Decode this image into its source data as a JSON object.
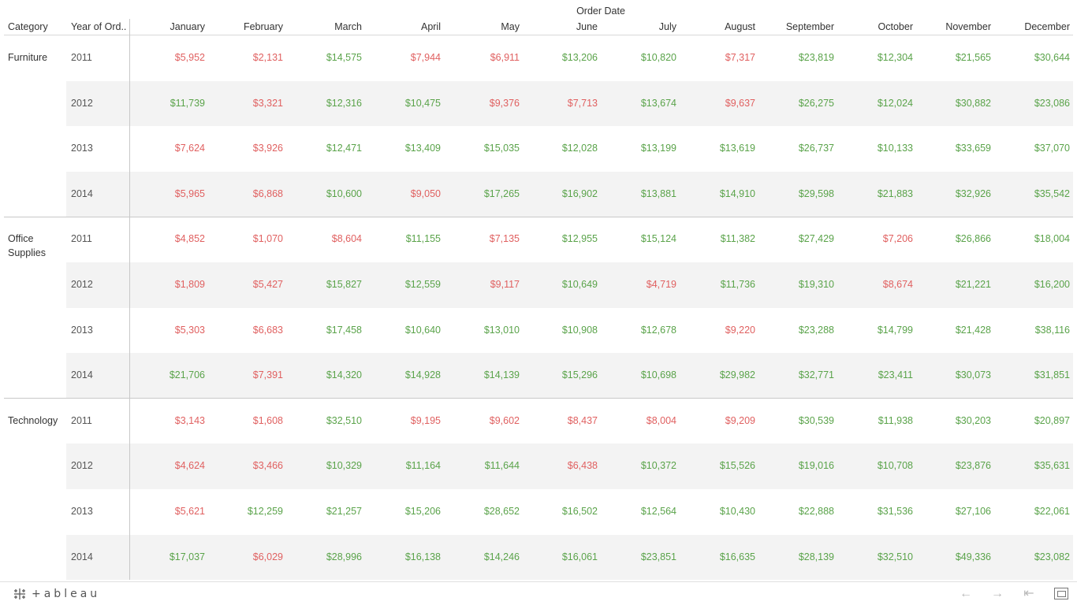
{
  "chart_data": {
    "type": "table",
    "column_group_title": "Order Date",
    "row_headers": [
      "Category",
      "Year of Ord.."
    ],
    "months": [
      "January",
      "February",
      "March",
      "April",
      "May",
      "June",
      "July",
      "August",
      "September",
      "October",
      "November",
      "December"
    ],
    "rows": [
      {
        "category": "Furniture",
        "years": [
          {
            "year": "2011",
            "values": [
              "$5,952",
              "$2,131",
              "$14,575",
              "$7,944",
              "$6,911",
              "$13,206",
              "$10,820",
              "$7,317",
              "$23,819",
              "$12,304",
              "$21,565",
              "$30,644"
            ],
            "positive": [
              0,
              0,
              1,
              0,
              0,
              1,
              1,
              0,
              1,
              1,
              1,
              1
            ]
          },
          {
            "year": "2012",
            "values": [
              "$11,739",
              "$3,321",
              "$12,316",
              "$10,475",
              "$9,376",
              "$7,713",
              "$13,674",
              "$9,637",
              "$26,275",
              "$12,024",
              "$30,882",
              "$23,086"
            ],
            "positive": [
              1,
              0,
              1,
              1,
              0,
              0,
              1,
              0,
              1,
              1,
              1,
              1
            ]
          },
          {
            "year": "2013",
            "values": [
              "$7,624",
              "$3,926",
              "$12,471",
              "$13,409",
              "$15,035",
              "$12,028",
              "$13,199",
              "$13,619",
              "$26,737",
              "$10,133",
              "$33,659",
              "$37,070"
            ],
            "positive": [
              0,
              0,
              1,
              1,
              1,
              1,
              1,
              1,
              1,
              1,
              1,
              1
            ]
          },
          {
            "year": "2014",
            "values": [
              "$5,965",
              "$6,868",
              "$10,600",
              "$9,050",
              "$17,265",
              "$16,902",
              "$13,881",
              "$14,910",
              "$29,598",
              "$21,883",
              "$32,926",
              "$35,542"
            ],
            "positive": [
              0,
              0,
              1,
              0,
              1,
              1,
              1,
              1,
              1,
              1,
              1,
              1
            ]
          }
        ]
      },
      {
        "category": "Office Supplies",
        "years": [
          {
            "year": "2011",
            "values": [
              "$4,852",
              "$1,070",
              "$8,604",
              "$11,155",
              "$7,135",
              "$12,955",
              "$15,124",
              "$11,382",
              "$27,429",
              "$7,206",
              "$26,866",
              "$18,004"
            ],
            "positive": [
              0,
              0,
              0,
              1,
              0,
              1,
              1,
              1,
              1,
              0,
              1,
              1
            ]
          },
          {
            "year": "2012",
            "values": [
              "$1,809",
              "$5,427",
              "$15,827",
              "$12,559",
              "$9,117",
              "$10,649",
              "$4,719",
              "$11,736",
              "$19,310",
              "$8,674",
              "$21,221",
              "$16,200"
            ],
            "positive": [
              0,
              0,
              1,
              1,
              0,
              1,
              0,
              1,
              1,
              0,
              1,
              1
            ]
          },
          {
            "year": "2013",
            "values": [
              "$5,303",
              "$6,683",
              "$17,458",
              "$10,640",
              "$13,010",
              "$10,908",
              "$12,678",
              "$9,220",
              "$23,288",
              "$14,799",
              "$21,428",
              "$38,116"
            ],
            "positive": [
              0,
              0,
              1,
              1,
              1,
              1,
              1,
              0,
              1,
              1,
              1,
              1
            ]
          },
          {
            "year": "2014",
            "values": [
              "$21,706",
              "$7,391",
              "$14,320",
              "$14,928",
              "$14,139",
              "$15,296",
              "$10,698",
              "$29,982",
              "$32,771",
              "$23,411",
              "$30,073",
              "$31,851"
            ],
            "positive": [
              1,
              0,
              1,
              1,
              1,
              1,
              1,
              1,
              1,
              1,
              1,
              1
            ]
          }
        ]
      },
      {
        "category": "Technology",
        "years": [
          {
            "year": "2011",
            "values": [
              "$3,143",
              "$1,608",
              "$32,510",
              "$9,195",
              "$9,602",
              "$8,437",
              "$8,004",
              "$9,209",
              "$30,539",
              "$11,938",
              "$30,203",
              "$20,897"
            ],
            "positive": [
              0,
              0,
              1,
              0,
              0,
              0,
              0,
              0,
              1,
              1,
              1,
              1
            ]
          },
          {
            "year": "2012",
            "values": [
              "$4,624",
              "$3,466",
              "$10,329",
              "$11,164",
              "$11,644",
              "$6,438",
              "$10,372",
              "$15,526",
              "$19,016",
              "$10,708",
              "$23,876",
              "$35,631"
            ],
            "positive": [
              0,
              0,
              1,
              1,
              1,
              0,
              1,
              1,
              1,
              1,
              1,
              1
            ]
          },
          {
            "year": "2013",
            "values": [
              "$5,621",
              "$12,259",
              "$21,257",
              "$15,206",
              "$28,652",
              "$16,502",
              "$12,564",
              "$10,430",
              "$22,888",
              "$31,536",
              "$27,106",
              "$22,061"
            ],
            "positive": [
              0,
              1,
              1,
              1,
              1,
              1,
              1,
              1,
              1,
              1,
              1,
              1
            ]
          },
          {
            "year": "2014",
            "values": [
              "$17,037",
              "$6,029",
              "$28,996",
              "$16,138",
              "$14,246",
              "$16,061",
              "$23,851",
              "$16,635",
              "$28,139",
              "$32,510",
              "$49,336",
              "$23,082"
            ],
            "positive": [
              1,
              0,
              1,
              1,
              1,
              1,
              1,
              1,
              1,
              1,
              1,
              1
            ]
          }
        ]
      }
    ],
    "colors": {
      "positive": "#5aa34a",
      "negative": "#e06060"
    }
  },
  "footer": {
    "logo_text": "+ableau",
    "nav_icons": [
      "undo-icon",
      "redo-icon",
      "revert-icon",
      "fullscreen-icon"
    ]
  }
}
